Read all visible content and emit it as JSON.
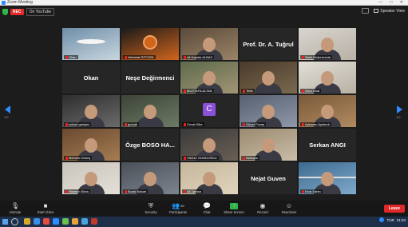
{
  "window": {
    "title": "Zoom Meeting"
  },
  "top_bar": {
    "rec_label": "REC",
    "live_label": "On YouTube",
    "speaker_view_label": "Speaker View",
    "pager_left": "1/2",
    "pager_right": "1/2"
  },
  "tiles": [
    {
      "kind": "video",
      "caption": "Okan",
      "scene": "bird",
      "colors": [
        "#6e8ea8",
        "#c9d6df"
      ]
    },
    {
      "kind": "video",
      "caption": "Nebahat ÖZTÜRK",
      "scene": "logo",
      "colors": [
        "#1a1a1a",
        "#d1651c"
      ]
    },
    {
      "kind": "video",
      "caption": "Ali Haydar ALBAZ",
      "scene": "person",
      "colors": [
        "#5a4a3a",
        "#9b8467"
      ]
    },
    {
      "kind": "name",
      "name": "Prof. Dr. A. Tuğrul"
    },
    {
      "kind": "video",
      "caption": "Sami Abdurrezzak",
      "scene": "person",
      "colors": [
        "#d8d5cf",
        "#b8b1a6"
      ]
    },
    {
      "kind": "name",
      "name": "Okan"
    },
    {
      "kind": "name",
      "name": "Neşe Değirmenci"
    },
    {
      "kind": "video",
      "caption": "MUSTAFA ALTAN",
      "scene": "person",
      "colors": [
        "#5c6b4c",
        "#a29475"
      ],
      "active": true
    },
    {
      "kind": "video",
      "caption": "Tekin",
      "scene": "shelf",
      "colors": [
        "#4a3a2a",
        "#7a6a50"
      ]
    },
    {
      "kind": "video",
      "caption": "Onur Ünal",
      "scene": "person",
      "colors": [
        "#e2dfd8",
        "#b7b0a2"
      ]
    },
    {
      "kind": "video",
      "caption": "yuksel ganiyev",
      "scene": "person",
      "colors": [
        "#2e2e2e",
        "#6b6b6b"
      ]
    },
    {
      "kind": "video",
      "caption": "gurcan",
      "scene": "person",
      "colors": [
        "#3c4438",
        "#6d7a63"
      ]
    },
    {
      "kind": "avatar",
      "letter": "C",
      "caption": "Cevat Ülke"
    },
    {
      "kind": "video",
      "caption": "Güner Fozay",
      "scene": "person",
      "colors": [
        "#566070",
        "#8f98a8"
      ]
    },
    {
      "kind": "video",
      "caption": "Aykanan Aydemir",
      "scene": "person",
      "colors": [
        "#7a5a3a",
        "#b08a60"
      ]
    },
    {
      "kind": "video",
      "caption": "Mehmet Güneş",
      "scene": "person",
      "colors": [
        "#6a4a30",
        "#a67c52"
      ]
    },
    {
      "kind": "name",
      "name": "Özge BOSO HA..."
    },
    {
      "kind": "video",
      "caption": "YAVUZ GÜNDOĞDU",
      "scene": "person",
      "colors": [
        "#3a3a3a",
        "#6a5f55"
      ]
    },
    {
      "kind": "video",
      "caption": "Nebayla",
      "scene": "person",
      "colors": [
        "#9a8a70",
        "#c9bda7"
      ]
    },
    {
      "kind": "name",
      "name": "Serkan ANGI"
    },
    {
      "kind": "video",
      "caption": "Hüseyin Elma",
      "scene": "person",
      "colors": [
        "#c9c4bb",
        "#e4e0d8"
      ]
    },
    {
      "kind": "video",
      "caption": "Burak Batuer",
      "scene": "person",
      "colors": [
        "#4a5058",
        "#7c848e"
      ]
    },
    {
      "kind": "video",
      "caption": "Ali Zaman",
      "scene": "person",
      "colors": [
        "#c6b79b",
        "#e0d4bd"
      ]
    },
    {
      "kind": "name",
      "name": "Nejat Guven"
    },
    {
      "kind": "video",
      "caption": "Esra Sahin",
      "scene": "bridge",
      "colors": [
        "#3d6a8f",
        "#7fa9c9"
      ]
    }
  ],
  "toolbar": {
    "unmute_label": "Unmute",
    "start_video_label": "Start Video",
    "security_label": "Security",
    "participants_label": "Participants",
    "participants_count": "50",
    "chat_label": "Chat",
    "share_label": "Share Screen",
    "record_label": "Record",
    "reactions_label": "Reactions",
    "leave_label": "Leave"
  },
  "taskbar": {
    "time": "21:04",
    "lang": "TUR",
    "apps": [
      "#d9a92a",
      "#3a8ee6",
      "#e84c3d",
      "#2d8cff",
      "#6bbf4e",
      "#e8a33c",
      "#4aa3df",
      "#c0392b"
    ]
  },
  "colors": {
    "accent": "#2d8cff",
    "rec": "#e02828",
    "share": "#2fb34a",
    "active": "#3fcf5c"
  }
}
